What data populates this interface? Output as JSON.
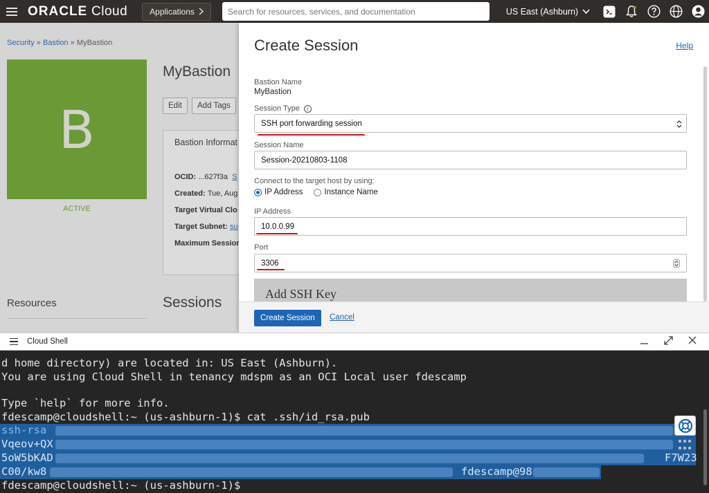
{
  "nav": {
    "logo_brand": "ORACLE",
    "logo_product": " Cloud",
    "applications_label": "Applications",
    "search_placeholder": "Search for resources, services, and documentation",
    "region_label": "US East (Ashburn)"
  },
  "breadcrumb": {
    "security": "Security",
    "sep1": " » ",
    "bastion": "Bastion",
    "sep2": " » ",
    "current": "MyBastion"
  },
  "bastion_page": {
    "tile_letter": "B",
    "status": "ACTIVE",
    "title": "MyBastion",
    "edit_label": "Edit",
    "add_tags_label": "Add Tags",
    "info_heading": "Bastion Informat",
    "ocid_label": "OCID: ",
    "ocid_value": "...627f3a",
    "ocid_link": "S",
    "created_label": "Created: ",
    "created_value": "Tue, Aug",
    "vcn_label": "Target Virtual Clo",
    "subnet_label": "Target Subnet: ",
    "subnet_link": "su",
    "max_session_label": "Maximum Session",
    "resources_heading": "Resources",
    "sessions_heading": "Sessions"
  },
  "panel": {
    "title": "Create Session",
    "help_label": "Help",
    "bastion_name_label": "Bastion Name",
    "bastion_name_value": "MyBastion",
    "session_type_label": "Session Type",
    "session_type_value": "SSH port forwarding session",
    "session_name_label": "Session Name",
    "session_name_value": "Session-20210803-1108",
    "connect_label": "Connect to the target host by using:",
    "radio_ip": "IP Address",
    "radio_instance": "Instance Name",
    "ip_label": "IP Address",
    "ip_value": "10.0.0.99",
    "port_label": "Port",
    "port_value": "3306",
    "ssh_key_heading": "Add SSH Key",
    "create_button": "Create Session",
    "cancel_label": "Cancel"
  },
  "shell": {
    "title": "Cloud Shell",
    "lines": {
      "l1": "d home directory) are located in: US East (Ashburn).",
      "l2": "You are using Cloud Shell in tenancy mdspm as an OCI Local user fdescamp",
      "l3": "Type `help` for more info.",
      "l4_prompt": "fdescamp@cloudshell:~ (us-ashburn-1)$ ",
      "l4_cmd": "cat .ssh/id_rsa.pub",
      "k1": "ssh-rsa",
      "k2": "Vqeov+QX",
      "k3": "5oW5bKAD",
      "k3_end": "F7W23",
      "k4": "C00/kw8",
      "k4_end": "fdescamp@98",
      "l9": "fdescamp@cloudshell:~ (us-ashburn-1)$ "
    }
  },
  "colors": {
    "topbar": "#312d2a",
    "accent": "#1e65b5",
    "bastion_green": "#6aa329",
    "annotation_red": "#d01010",
    "terminal_bg": "#252525",
    "selection": "#1f5f9f"
  }
}
